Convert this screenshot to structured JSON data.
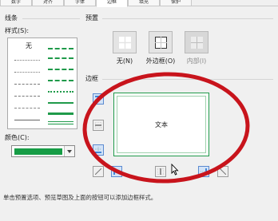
{
  "tabs": [
    {
      "label": "数字"
    },
    {
      "label": "对齐"
    },
    {
      "label": "字体"
    },
    {
      "label": "边框"
    },
    {
      "label": "填充"
    },
    {
      "label": "保护"
    }
  ],
  "line": {
    "group_label": "线条",
    "style_label": "样式(S):",
    "none_label": "无",
    "color_label": "颜色(C):",
    "color_value": "#169c45"
  },
  "presets": {
    "group_label": "预置",
    "items": [
      {
        "label": "无(N)",
        "icon": "preset-none-icon"
      },
      {
        "label": "外边框(O)",
        "icon": "preset-outline-icon"
      },
      {
        "label": "内部(I)",
        "icon": "preset-inside-icon"
      }
    ]
  },
  "border": {
    "group_label": "边框",
    "preview_text": "文本",
    "accent_color": "#1f9a4a"
  },
  "hint": "单击预置选项、预览草图及上面的按钮可以添加边框样式。"
}
